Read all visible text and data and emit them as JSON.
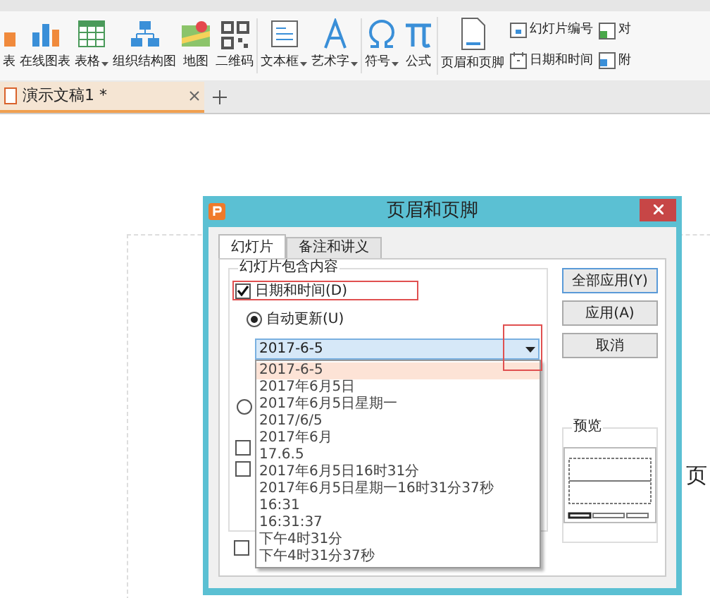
{
  "toolbar": {
    "groups": [
      {
        "items": [
          {
            "label": "表",
            "dropdown": false
          },
          {
            "label": "在线图表",
            "dropdown": false
          },
          {
            "label": "表格",
            "dropdown": true
          },
          {
            "label": "组织结构图",
            "dropdown": false
          },
          {
            "label": "地图",
            "dropdown": false
          },
          {
            "label": "二维码",
            "dropdown": false
          }
        ]
      },
      {
        "items": [
          {
            "label": "文本框",
            "dropdown": true
          },
          {
            "label": "艺术字",
            "dropdown": true
          }
        ]
      },
      {
        "items": [
          {
            "label": "符号",
            "dropdown": true
          },
          {
            "label": "公式",
            "dropdown": false
          }
        ]
      },
      {
        "items": [
          {
            "label": "页眉和页脚",
            "dropdown": false
          }
        ]
      }
    ],
    "small_items": [
      {
        "label": "幻灯片编号"
      },
      {
        "label": "日期和时间"
      },
      {
        "label": "对"
      },
      {
        "label": "附"
      }
    ]
  },
  "document_tabs": [
    {
      "label": "演示文稿1 *",
      "selected": true
    }
  ],
  "slide_text": "页",
  "dialog": {
    "title": "页眉和页脚",
    "tabs": [
      {
        "label": "幻灯片",
        "selected": true
      },
      {
        "label": "备注和讲义",
        "selected": false
      }
    ],
    "group_title": "幻灯片包含内容",
    "date_checkbox": {
      "label": "日期和时间(D)",
      "checked": true
    },
    "auto_update": {
      "label": "自动更新(U)",
      "selected": true
    },
    "combo_value": "2017-6-5",
    "options": [
      {
        "label": "2017-6-5",
        "selected": true
      },
      {
        "label": "2017年6月5日",
        "selected": false
      },
      {
        "label": "2017年6月5日星期一",
        "selected": false
      },
      {
        "label": "2017/6/5",
        "selected": false
      },
      {
        "label": "2017年6月",
        "selected": false
      },
      {
        "label": "17.6.5",
        "selected": false
      },
      {
        "label": "2017年6月5日16时31分",
        "selected": false
      },
      {
        "label": "2017年6月5日星期一16时31分37秒",
        "selected": false
      },
      {
        "label": "16:31",
        "selected": false
      },
      {
        "label": "16:31:37",
        "selected": false
      },
      {
        "label": "下午4时31分",
        "selected": false
      },
      {
        "label": "下午4时31分37秒",
        "selected": false
      }
    ],
    "fixed_radio": {
      "selected": false
    },
    "hidden_checkboxes": [
      {
        "checked": false
      },
      {
        "checked": false
      }
    ],
    "bottom_checkbox": {
      "checked": false
    },
    "buttons": [
      "全部应用(Y)",
      "应用(A)",
      "取消"
    ],
    "preview_title": "预览"
  }
}
